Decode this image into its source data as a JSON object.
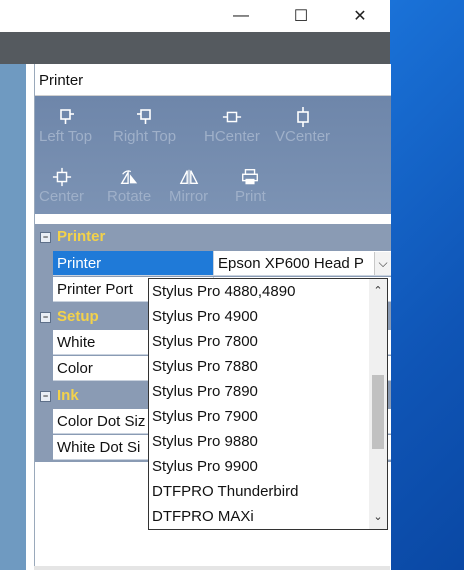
{
  "window": {
    "minimize_glyph": "—",
    "maximize_glyph": "☐",
    "close_glyph": "✕"
  },
  "panel": {
    "title": "Printer"
  },
  "toolbar": {
    "items": [
      {
        "label": "Left Top",
        "icon": "left-top-align-icon"
      },
      {
        "label": "Right Top",
        "icon": "right-top-align-icon"
      },
      {
        "label": "HCenter",
        "icon": "horizontal-center-icon"
      },
      {
        "label": "VCenter",
        "icon": "vertical-center-icon"
      },
      {
        "label": "Center",
        "icon": "center-icon"
      },
      {
        "label": "Rotate",
        "icon": "rotate-icon"
      },
      {
        "label": "Mirror",
        "icon": "mirror-icon"
      },
      {
        "label": "Print",
        "icon": "print-icon"
      }
    ]
  },
  "property_grid": {
    "collapse_glyph": "−",
    "categories": {
      "printer": "Printer",
      "setup": "Setup",
      "ink": "Ink"
    },
    "rows": {
      "printer": {
        "name": "Printer",
        "value": "Epson XP600 Head P"
      },
      "printer_port": {
        "name": "Printer Port",
        "value": ""
      },
      "white": {
        "name": "White",
        "value": ""
      },
      "color": {
        "name": "Color",
        "value": ""
      },
      "color_dot_size": {
        "name": "Color Dot Siz",
        "value": ""
      },
      "white_dot_size": {
        "name": "White Dot Si",
        "value": ""
      }
    },
    "dropdown_arrow": "⌵"
  },
  "printer_dropdown": {
    "options": [
      "Stylus Pro 4880,4890",
      "Stylus Pro 4900",
      "Stylus Pro 7800",
      "Stylus Pro 7880",
      "Stylus Pro 7890",
      "Stylus Pro 7900",
      "Stylus Pro 9880",
      "Stylus Pro 9900",
      "DTFPRO Thunderbird",
      "DTFPRO MAXi"
    ],
    "scroll_up": "⌃",
    "scroll_down": "⌄"
  },
  "colors": {
    "accent_selected": "#1f7ad8",
    "category_text": "#f3d24a",
    "desktop": "#1565c8"
  }
}
